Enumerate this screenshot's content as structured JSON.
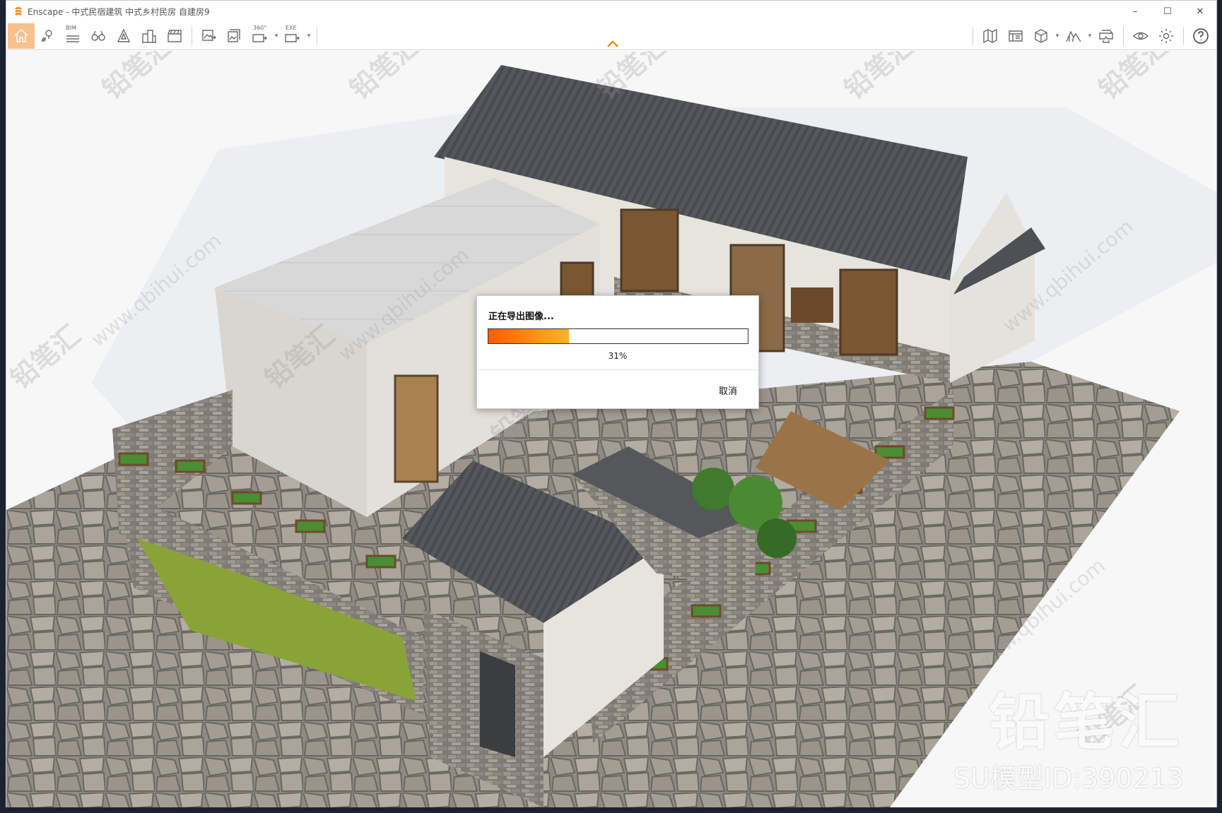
{
  "window": {
    "title": "Enscape - 中式民宿建筑 中式乡村民房 自建房9",
    "controls": {
      "minimize": "–",
      "maximize": "☐",
      "close": "✕"
    }
  },
  "toolbar": {
    "left_buttons": [
      {
        "name": "home",
        "icon": "home-icon"
      },
      {
        "name": "views",
        "icon": "location-pin-icon"
      },
      {
        "name": "bim",
        "icon": "bim-list-icon",
        "tag": "BIM"
      },
      {
        "name": "binoculars",
        "icon": "binoculars-icon"
      },
      {
        "name": "assets",
        "icon": "triangle-shape-icon"
      },
      {
        "name": "buildings",
        "icon": "buildings-icon"
      },
      {
        "name": "video",
        "icon": "clapperboard-icon"
      },
      {
        "name": "screenshot",
        "icon": "image-export-icon"
      },
      {
        "name": "batch",
        "icon": "batch-render-icon"
      },
      {
        "name": "panorama",
        "icon": "panorama-icon",
        "tag": "360°"
      },
      {
        "name": "exe",
        "icon": "exe-export-icon",
        "tag": "EXE"
      }
    ],
    "right_buttons": [
      {
        "name": "map",
        "icon": "map-icon"
      },
      {
        "name": "sheet",
        "icon": "sheet-icon"
      },
      {
        "name": "cube",
        "icon": "cube-icon"
      },
      {
        "name": "sky",
        "icon": "mountain-icon"
      },
      {
        "name": "vr",
        "icon": "vr-headset-icon"
      },
      {
        "name": "visibility",
        "icon": "eye-icon"
      },
      {
        "name": "settings",
        "icon": "gear-icon"
      },
      {
        "name": "help",
        "icon": "help-icon"
      }
    ]
  },
  "dialog": {
    "title": "正在导出图像...",
    "progress": 0.31,
    "percent_label": "31%",
    "cancel_label": "取消",
    "accent": "#ff7a0a"
  },
  "watermark": {
    "brand": "铅笔汇",
    "model_id": "SU模型ID:390213",
    "tile_text": "铅笔汇",
    "url_text": "www.qbihui.com"
  }
}
